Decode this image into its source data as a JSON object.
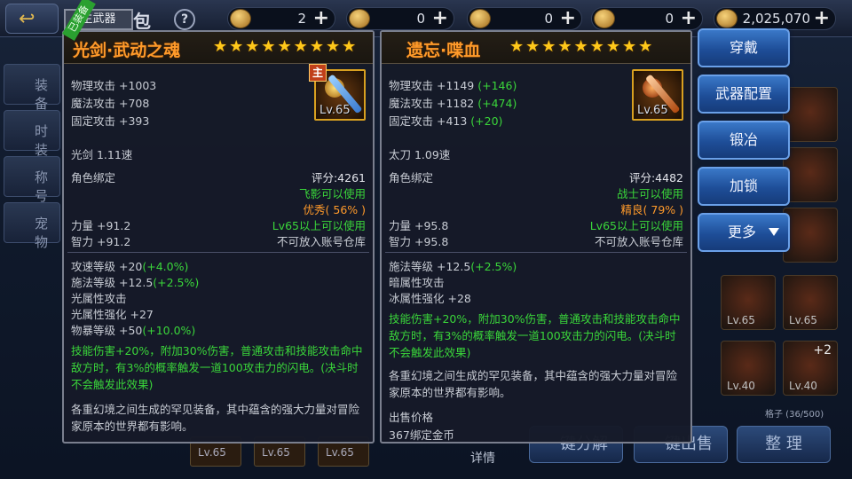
{
  "header": {
    "page_title": "背包",
    "help": "?",
    "currencies": [
      {
        "value": "2",
        "plus": "+"
      },
      {
        "value": "0",
        "plus": "+"
      },
      {
        "value": "0",
        "plus": "+"
      },
      {
        "value": "0",
        "plus": "+"
      },
      {
        "value": "2,025,070",
        "plus": "+"
      }
    ]
  },
  "left_tabs": [
    "装备",
    "时装",
    "称号",
    "宠物"
  ],
  "equipped_panel": {
    "slot_tag": "主武器",
    "equipped_ribbon": "已装备",
    "name": "光剑·武动之魂",
    "stars": "★★★★★★★★★",
    "level": "Lv.65",
    "main_badge": "主",
    "stats": [
      "物理攻击 +1003",
      "魔法攻击 +708",
      "固定攻击 +393"
    ],
    "weapon_type": "光剑 1.11速",
    "bind": "角色绑定",
    "score": "评分:4261",
    "usable": "飞影可以使用",
    "quality": "优秀( 56% )",
    "str": "力量 +91.2",
    "int": "智力 +91.2",
    "req_level": "Lv65以上可以使用",
    "no_store": "不可放入账号仓库",
    "extra": [
      {
        "text": "攻速等级 +20",
        "bonus": "(+4.0%)"
      },
      {
        "text": "施法等级 +12.5",
        "bonus": "(+2.5%)"
      },
      {
        "text": "光属性攻击",
        "bonus": ""
      },
      {
        "text": "光属性强化 +27",
        "bonus": ""
      },
      {
        "text": "物暴等级 +50",
        "bonus": "(+10.0%)"
      }
    ],
    "skill_desc": "技能伤害+20%，附加30%伤害，普通攻击和技能攻击命中敌方时，有3%的概率触发一道100攻击力的闪电。(决斗时不会触发此效果)",
    "lore": "各重幻境之间生成的罕见装备，其中蕴含的强大力量对冒险家原本的世界都有影响。"
  },
  "compare_panel": {
    "name": "遗忘·喋血",
    "stars": "★★★★★★★★★",
    "level": "Lv.65",
    "stats": [
      {
        "text": "物理攻击 +1149",
        "bonus": "(+146)"
      },
      {
        "text": "魔法攻击 +1182",
        "bonus": "(+474)"
      },
      {
        "text": "固定攻击 +413",
        "bonus": "(+20)"
      }
    ],
    "weapon_type": "太刀 1.09速",
    "bind": "角色绑定",
    "score": "评分:4482",
    "usable": "战士可以使用",
    "quality": "精良( 79% )",
    "str": "力量 +95.8",
    "int": "智力 +95.8",
    "req_level": "Lv65以上可以使用",
    "no_store": "不可放入账号仓库",
    "extra": [
      {
        "text": "施法等级 +12.5",
        "bonus": "(+2.5%)"
      },
      {
        "text": "暗属性攻击",
        "bonus": ""
      },
      {
        "text": "冰属性强化 +28",
        "bonus": ""
      }
    ],
    "skill_desc": "技能伤害+20%，附加30%伤害，普通攻击和技能攻击命中敌方时，有3%的概率触发一道100攻击力的闪电。(决斗时不会触发此效果)",
    "lore": "各重幻境之间生成的罕见装备，其中蕴含的强大力量对冒险家原本的世界都有影响。",
    "sell_label": "出售价格",
    "sell_value": "367绑定金币"
  },
  "actions": [
    "穿戴",
    "武器配置",
    "锻冶",
    "加锁",
    "更多"
  ],
  "background": {
    "cell_levels": [
      "Lv.65",
      "Lv.65",
      "Lv.65",
      "Lv.40",
      "Lv.40"
    ],
    "slots_info": "格子 (36/500)",
    "detail_label": "详情",
    "bottom_buttons": [
      "一键分解",
      "一键出售",
      "整 理"
    ],
    "bottom_slots": [
      "Lv.65",
      "Lv.65",
      "Lv.65"
    ],
    "plus_two": "+2",
    "tab_hint": "装备"
  }
}
